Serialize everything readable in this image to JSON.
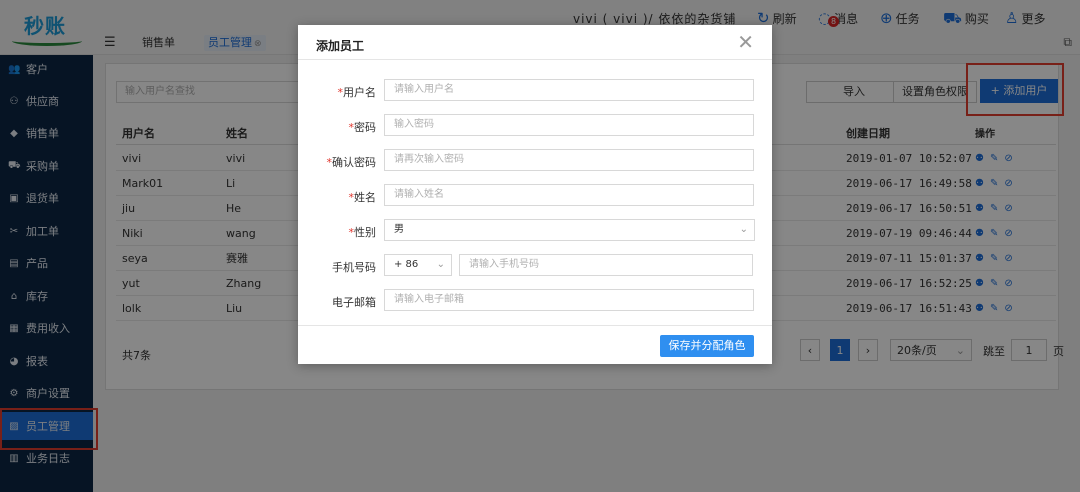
{
  "header": {
    "logo_text": "秒账",
    "store_info": "vivi ( vivi )/ 依依的杂货铺",
    "refresh_label": "刷新",
    "messages_label": "消息",
    "messages_badge": "8",
    "tasks_label": "任务",
    "buy_label": "购买",
    "more_label": "更多"
  },
  "tabs": [
    {
      "label": "销售单"
    },
    {
      "label": "员工管理"
    }
  ],
  "sidebar": {
    "items": [
      {
        "label": "客户",
        "icon": "users-icon"
      },
      {
        "label": "供应商",
        "icon": "supplier-icon"
      },
      {
        "label": "销售单",
        "icon": "tag-icon"
      },
      {
        "label": "采购单",
        "icon": "cart-icon"
      },
      {
        "label": "退货单",
        "icon": "return-icon"
      },
      {
        "label": "加工单",
        "icon": "tools-icon"
      },
      {
        "label": "产品",
        "icon": "gift-icon"
      },
      {
        "label": "库存",
        "icon": "warehouse-icon"
      },
      {
        "label": "费用收入",
        "icon": "invoice-icon"
      },
      {
        "label": "报表",
        "icon": "piechart-icon"
      },
      {
        "label": "商户设置",
        "icon": "gear-icon"
      },
      {
        "label": "员工管理",
        "icon": "staff-icon"
      },
      {
        "label": "业务日志",
        "icon": "log-icon"
      }
    ],
    "active_index": 11
  },
  "main": {
    "search_placeholder": "输入用户名查找",
    "import_label": "导入",
    "role_perm_label": "设置角色权限",
    "add_user_label": "+ 添加用户",
    "columns": {
      "username": "用户名",
      "name": "姓名",
      "created": "创建日期",
      "ops": "操作"
    },
    "rows": [
      {
        "username": "vivi",
        "name": "vivi",
        "created": "2019-01-07 10:52:07"
      },
      {
        "username": "Mark01",
        "name": "Li",
        "created": "2019-06-17 16:49:58"
      },
      {
        "username": "jiu",
        "name": "He",
        "created": "2019-06-17 16:50:51"
      },
      {
        "username": "Niki",
        "name": "wang",
        "created": "2019-07-19 09:46:44"
      },
      {
        "username": "seya",
        "name": "赛雅",
        "created": "2019-07-11 15:01:37"
      },
      {
        "username": "yut",
        "name": "Zhang",
        "created": "2019-06-17 16:52:25"
      },
      {
        "username": "lolk",
        "name": "Liu",
        "created": "2019-06-17 16:51:43"
      }
    ],
    "total": "共7条",
    "pager": {
      "current": "1",
      "page_size": "20条/页",
      "goto_label": "跳至",
      "goto_value": "1",
      "page_suffix": "页"
    }
  },
  "modal": {
    "title": "添加员工",
    "fields": [
      {
        "label": "用户名",
        "required": true,
        "placeholder": "请输入用户名"
      },
      {
        "label": "密码",
        "required": true,
        "placeholder": "输入密码"
      },
      {
        "label": "确认密码",
        "required": true,
        "placeholder": "请再次输入密码"
      },
      {
        "label": "姓名",
        "required": true,
        "placeholder": "请输入姓名"
      },
      {
        "label": "性别",
        "required": true,
        "value": "男"
      },
      {
        "label": "手机号码",
        "required": false,
        "country_code": "+ 86",
        "placeholder": "请输入手机号码"
      },
      {
        "label": "电子邮箱",
        "required": false,
        "placeholder": "请输入电子邮箱"
      }
    ],
    "save_label": "保存并分配角色"
  },
  "colors": {
    "primary": "#1e6fd9",
    "sidebar_bg": "#0d2745",
    "highlight": "#e23d2f",
    "required": "#e0342c"
  }
}
